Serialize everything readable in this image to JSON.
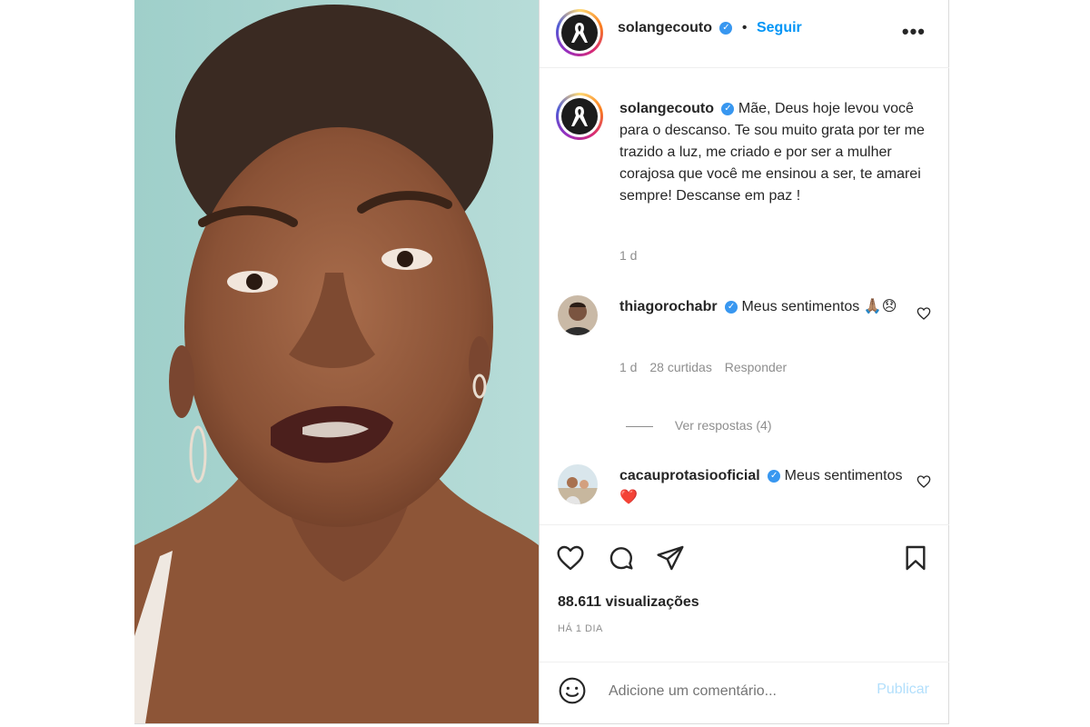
{
  "header": {
    "username": "solangecouto",
    "follow_label": "Seguir",
    "separator": "•",
    "more_label": "•••"
  },
  "caption": {
    "username": "solangecouto",
    "text": "Mãe, Deus hoje levou você para o descanso. Te sou muito grata por ter me trazido a luz, me criado e por ser a mulher corajosa que você me ensinou a ser, te amarei sempre! Descanse em paz !",
    "time": "1 d"
  },
  "comments": [
    {
      "username": "thiagorochabr",
      "text": "Meus sentimentos",
      "emoji": "🙏🏽😞",
      "time": "1 d",
      "likes": "28 curtidas",
      "reply_label": "Responder",
      "view_replies": "Ver respostas (4)"
    },
    {
      "username": "cacauprotasiooficial",
      "text": "Meus sentimentos",
      "emoji": "❤️"
    }
  ],
  "stats": {
    "views": "88.611 visualizações",
    "date": "HÁ 1 DIA"
  },
  "composer": {
    "placeholder": "Adicione um comentário...",
    "publish_label": "Publicar"
  },
  "icons": {
    "avatar_symbol": "ribbon-icon",
    "verified": "✓"
  },
  "colors": {
    "link_blue": "#0095f6",
    "verified_blue": "#3897f0",
    "publish_disabled": "#b2dffc"
  }
}
